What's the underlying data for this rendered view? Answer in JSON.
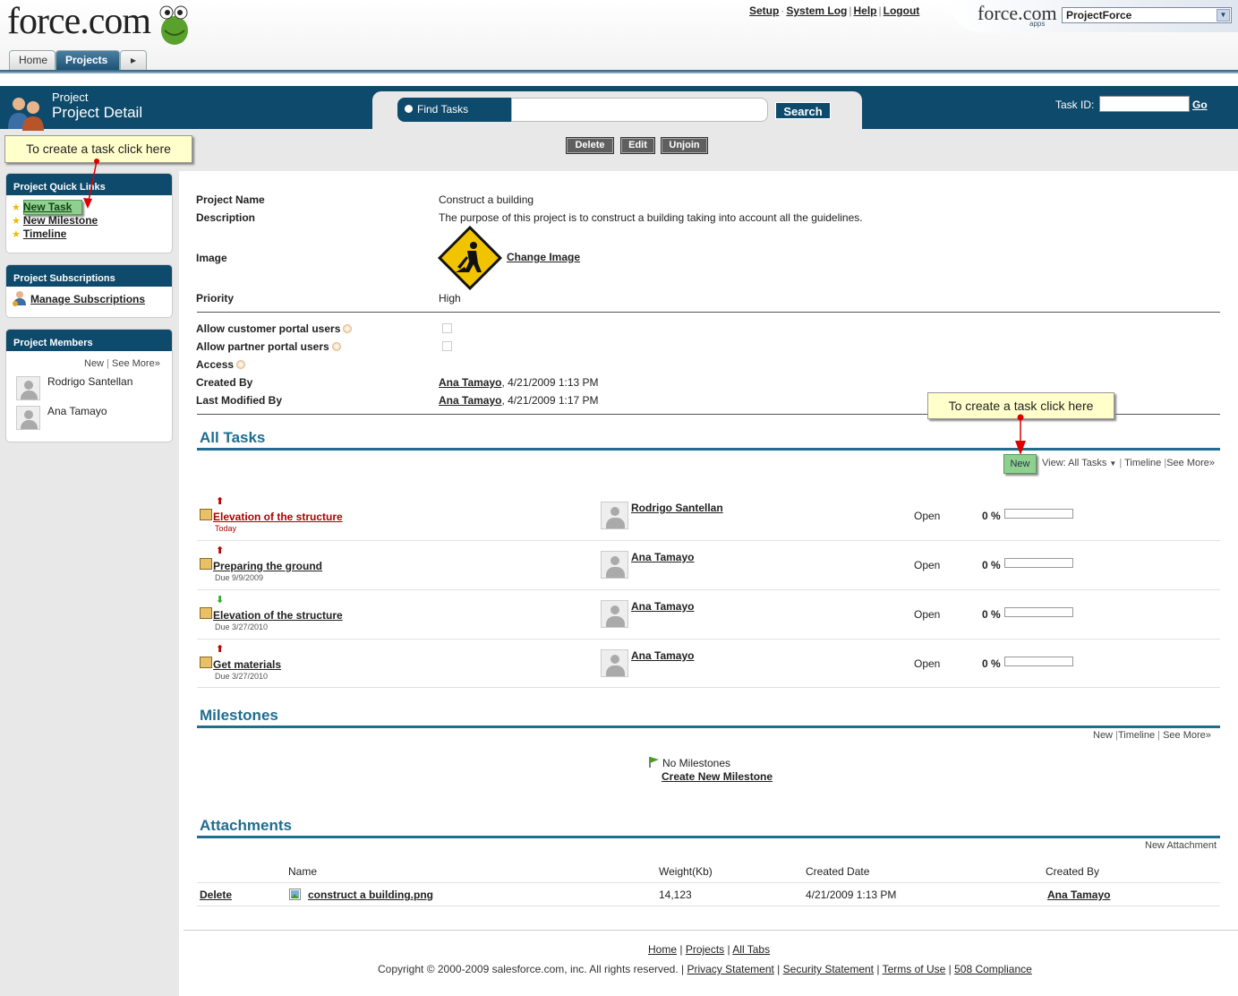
{
  "header": {
    "logo_text": "force.com",
    "top_links": [
      "Setup",
      "System Log",
      "Help",
      "Logout"
    ],
    "apps_logo": "force.com",
    "apps_sub": "apps",
    "app_select": "ProjectForce",
    "tabs": [
      "Home",
      "Projects"
    ]
  },
  "page_header": {
    "type": "Project",
    "title": "Project Detail",
    "find_label": "Find Tasks",
    "search_button": "Search",
    "task_id_label": "Task ID:",
    "go_label": "Go",
    "buttons": [
      "Delete",
      "Edit",
      "Unjoin"
    ]
  },
  "callouts": {
    "sidebar": "To create a task click here",
    "tasks": "To create a task click here"
  },
  "sidebar": {
    "quick_links_title": "Project Quick Links",
    "quick_links": [
      "New Task",
      "New Milestone",
      "Timeline"
    ],
    "subscriptions_title": "Project Subscriptions",
    "manage_subscriptions": "Manage Subscriptions",
    "members_title": "Project Members",
    "members_new": "New",
    "members_see_more": "See More»",
    "members": [
      "Rodrigo Santellan",
      "Ana Tamayo"
    ]
  },
  "detail": {
    "project_name_label": "Project Name",
    "project_name": "Construct a building",
    "description_label": "Description",
    "description": "The purpose of this project is to construct a building taking into account all the guidelines.",
    "image_label": "Image",
    "change_image": "Change Image",
    "priority_label": "Priority",
    "priority": "High",
    "allow_customer_label": "Allow customer portal users",
    "allow_partner_label": "Allow partner portal users",
    "access_label": "Access",
    "created_by_label": "Created By",
    "created_by_user": "Ana Tamayo",
    "created_by_date": ", 4/21/2009 1:13 PM",
    "modified_by_label": "Last Modified By",
    "modified_by_user": "Ana Tamayo",
    "modified_by_date": ", 4/21/2009 1:17 PM"
  },
  "tasks": {
    "title": "All Tasks",
    "new_label": "New",
    "view_label": "View: All Tasks",
    "timeline": "Timeline",
    "see_more": "See More»",
    "rows": [
      {
        "name": "Elevation of the structure",
        "due": "Today",
        "priority": "up",
        "assignee": "Rodrigo Santellan",
        "status": "Open",
        "percent": "0 %"
      },
      {
        "name": "Preparing the ground",
        "due": "Due 9/9/2009",
        "priority": "up",
        "assignee": "Ana Tamayo",
        "status": "Open",
        "percent": "0 %"
      },
      {
        "name": "Elevation of the structure",
        "due": "Due 3/27/2010",
        "priority": "down",
        "assignee": "Ana Tamayo",
        "status": "Open",
        "percent": "0 %"
      },
      {
        "name": "Get materials",
        "due": "Due 3/27/2010",
        "priority": "up",
        "assignee": "Ana Tamayo",
        "status": "Open",
        "percent": "0 %"
      }
    ]
  },
  "milestones": {
    "title": "Milestones",
    "new_label": "New",
    "timeline": "Timeline",
    "see_more": "See More»",
    "empty_text": "No Milestones",
    "create_link": "Create New Milestone"
  },
  "attachments": {
    "title": "Attachments",
    "new_attachment": "New Attachment",
    "columns": [
      "Name",
      "Weight(Kb)",
      "Created Date",
      "Created By"
    ],
    "rows": [
      {
        "action": "Delete",
        "name": "construct a building.png",
        "weight": "14,123",
        "created_date": "4/21/2009 1:13 PM",
        "created_by": "Ana Tamayo"
      }
    ]
  },
  "footer": {
    "links": [
      "Home",
      "Projects",
      "All Tabs"
    ],
    "copyright": "Copyright © 2000-2009 salesforce.com, inc. All rights reserved. |",
    "legal_links": [
      "Privacy Statement",
      "Security Statement",
      "Terms of Use",
      "508 Compliance"
    ]
  },
  "colors": {
    "primary": "#0e4a6b",
    "section_heading": "#1f6d8f",
    "callout_bg": "#ffffcc",
    "new_button": "#8fcf8f",
    "overdue_link": "#b00000"
  }
}
